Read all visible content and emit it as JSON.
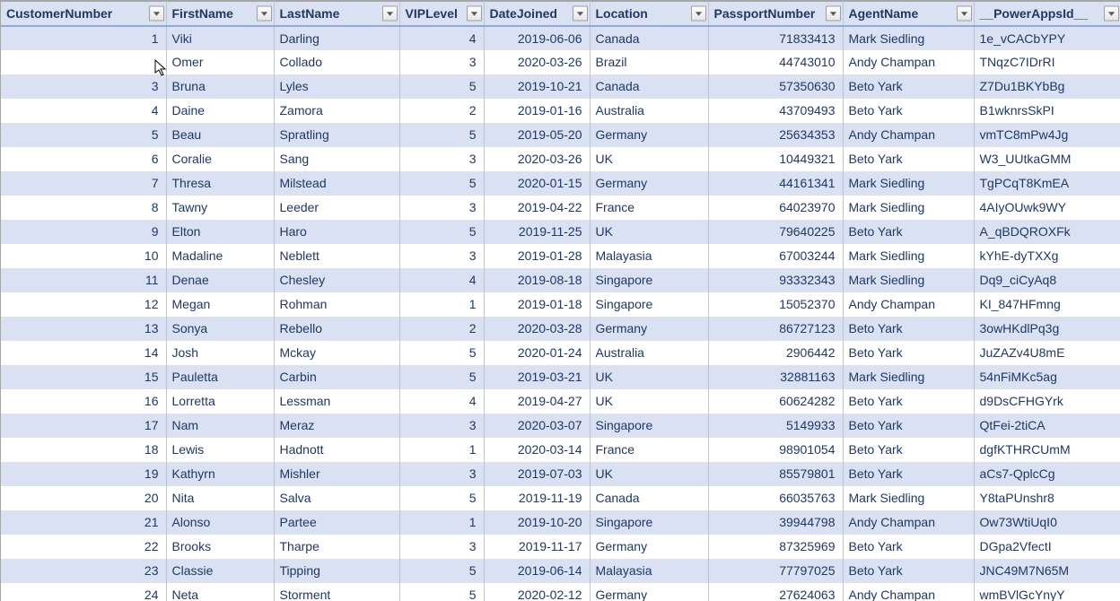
{
  "columns": [
    {
      "label": "CustomerNumber",
      "align": "num"
    },
    {
      "label": "FirstName",
      "align": "txt"
    },
    {
      "label": "LastName",
      "align": "txt"
    },
    {
      "label": "VIPLevel",
      "align": "num"
    },
    {
      "label": "DateJoined",
      "align": "num"
    },
    {
      "label": "Location",
      "align": "txt"
    },
    {
      "label": "PassportNumber",
      "align": "num"
    },
    {
      "label": "AgentName",
      "align": "txt"
    },
    {
      "label": "__PowerAppsId__",
      "align": "txt"
    }
  ],
  "rows": [
    [
      "1",
      "Viki",
      "Darling",
      "4",
      "2019-06-06",
      "Canada",
      "71833413",
      "Mark Siedling",
      "1e_vCACbYPY"
    ],
    [
      "",
      "Omer",
      "Collado",
      "3",
      "2020-03-26",
      "Brazil",
      "44743010",
      "Andy Champan",
      "TNqzC7IDrRI"
    ],
    [
      "3",
      "Bruna",
      "Lyles",
      "5",
      "2019-10-21",
      "Canada",
      "57350630",
      "Beto Yark",
      "Z7Du1BKYbBg"
    ],
    [
      "4",
      "Daine",
      "Zamora",
      "2",
      "2019-01-16",
      "Australia",
      "43709493",
      "Beto Yark",
      "B1wknrsSkPI"
    ],
    [
      "5",
      "Beau",
      "Spratling",
      "5",
      "2019-05-20",
      "Germany",
      "25634353",
      "Andy Champan",
      "vmTC8mPw4Jg"
    ],
    [
      "6",
      "Coralie",
      "Sang",
      "3",
      "2020-03-26",
      "UK",
      "10449321",
      "Beto Yark",
      "W3_UUtkaGMM"
    ],
    [
      "7",
      "Thresa",
      "Milstead",
      "5",
      "2020-01-15",
      "Germany",
      "44161341",
      "Mark Siedling",
      "TgPCqT8KmEA"
    ],
    [
      "8",
      "Tawny",
      "Leeder",
      "3",
      "2019-04-22",
      "France",
      "64023970",
      "Mark Siedling",
      "4AIyOUwk9WY"
    ],
    [
      "9",
      "Elton",
      "Haro",
      "5",
      "2019-11-25",
      "UK",
      "79640225",
      "Beto Yark",
      "A_qBDQROXFk"
    ],
    [
      "10",
      "Madaline",
      "Neblett",
      "3",
      "2019-01-28",
      "Malayasia",
      "67003244",
      "Mark Siedling",
      "kYhE-dyTXXg"
    ],
    [
      "11",
      "Denae",
      "Chesley",
      "4",
      "2019-08-18",
      "Singapore",
      "93332343",
      "Mark Siedling",
      "Dq9_ciCyAq8"
    ],
    [
      "12",
      "Megan",
      "Rohman",
      "1",
      "2019-01-18",
      "Singapore",
      "15052370",
      "Andy Champan",
      "KI_847HFmng"
    ],
    [
      "13",
      "Sonya",
      "Rebello",
      "2",
      "2020-03-28",
      "Germany",
      "86727123",
      "Beto Yark",
      "3owHKdlPq3g"
    ],
    [
      "14",
      "Josh",
      "Mckay",
      "5",
      "2020-01-24",
      "Australia",
      "2906442",
      "Beto Yark",
      "JuZAZv4U8mE"
    ],
    [
      "15",
      "Pauletta",
      "Carbin",
      "5",
      "2019-03-21",
      "UK",
      "32881163",
      "Mark Siedling",
      "54nFiMKc5ag"
    ],
    [
      "16",
      "Lorretta",
      "Lessman",
      "4",
      "2019-04-27",
      "UK",
      "60624282",
      "Beto Yark",
      "d9DsCFHGYrk"
    ],
    [
      "17",
      "Nam",
      "Meraz",
      "3",
      "2020-03-07",
      "Singapore",
      "5149933",
      "Beto Yark",
      "QtFei-2tiCA"
    ],
    [
      "18",
      "Lewis",
      "Hadnott",
      "1",
      "2020-03-14",
      "France",
      "98901054",
      "Beto Yark",
      "dgfKTHRCUmM"
    ],
    [
      "19",
      "Kathyrn",
      "Mishler",
      "3",
      "2019-07-03",
      "UK",
      "85579801",
      "Beto Yark",
      "aCs7-QplcCg"
    ],
    [
      "20",
      "Nita",
      "Salva",
      "5",
      "2019-11-19",
      "Canada",
      "66035763",
      "Mark Siedling",
      "Y8taPUnshr8"
    ],
    [
      "21",
      "Alonso",
      "Partee",
      "1",
      "2019-10-20",
      "Singapore",
      "39944798",
      "Andy Champan",
      "Ow73WtiUqI0"
    ],
    [
      "22",
      "Brooks",
      "Tharpe",
      "3",
      "2019-11-17",
      "Germany",
      "87325969",
      "Beto Yark",
      "DGpa2VfectI"
    ],
    [
      "23",
      "Classie",
      "Tipping",
      "5",
      "2019-06-14",
      "Malayasia",
      "77797025",
      "Beto Yark",
      "JNC49M7N65M"
    ],
    [
      "24",
      "Neta",
      "Storment",
      "5",
      "2020-02-12",
      "Germany",
      "27624063",
      "Andy Champan",
      "wmBVlGcYnyY"
    ]
  ]
}
